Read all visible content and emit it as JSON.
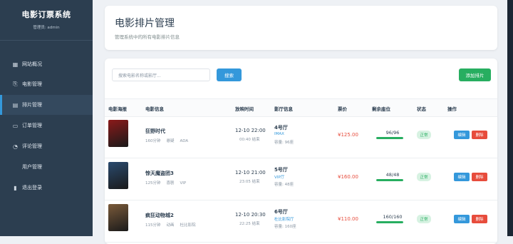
{
  "sidebar": {
    "brand": "电影订票系统",
    "admin": "管理员: admin",
    "items": [
      {
        "label": "网站概况",
        "icon": "dashboard-icon",
        "active": false
      },
      {
        "label": "电影管理",
        "icon": "film-icon",
        "active": false
      },
      {
        "label": "排片管理",
        "icon": "schedule-icon",
        "active": true
      },
      {
        "label": "订单管理",
        "icon": "ticket-icon",
        "active": false
      },
      {
        "label": "评论管理",
        "icon": "comment-icon",
        "active": false
      },
      {
        "label": "用户管理",
        "icon": "",
        "active": false
      },
      {
        "label": "退出登录",
        "icon": "logout-icon",
        "active": false
      }
    ]
  },
  "header": {
    "title": "电影排片管理",
    "subtitle": "管理系统中的所有电影排片信息"
  },
  "toolbar": {
    "search_placeholder": "搜索电影名称或影厅...",
    "search_label": "搜索",
    "add_label": "添加排片"
  },
  "table": {
    "columns": [
      "电影海报",
      "电影信息",
      "放映时间",
      "影厅信息",
      "票价",
      "剩余座位",
      "状态",
      "操作"
    ],
    "rows": [
      {
        "title": "狂野时代",
        "duration": "160分钟",
        "genre": "悬疑",
        "language": "ADA",
        "start": "12-10 22:00",
        "end": "00:40 结束",
        "hall": "4号厅",
        "hall_type": "IMAX",
        "capacity": "容量: 96座",
        "price": "¥125.00",
        "seats": "96/96",
        "seat_ratio": 1.0,
        "status": "正常",
        "edit": "编辑",
        "delete": "删除",
        "poster_color": "#8b1a1a"
      },
      {
        "title": "惊天魔盗团3",
        "duration": "125分钟",
        "genre": "喜剧",
        "language": "VIP",
        "start": "12-10 21:00",
        "end": "23:05 结束",
        "hall": "5号厅",
        "hall_type": "VIP厅",
        "capacity": "容量: 48座",
        "price": "¥160.00",
        "seats": "48/48",
        "seat_ratio": 1.0,
        "status": "正常",
        "edit": "编辑",
        "delete": "删除",
        "poster_color": "#2a4a6e"
      },
      {
        "title": "疯狂动物城2",
        "duration": "115分钟",
        "genre": "动画",
        "language": "杜比影院",
        "start": "12-10 20:30",
        "end": "22:25 结束",
        "hall": "6号厅",
        "hall_type": "杜比影院厅",
        "capacity": "容量: 160座",
        "price": "¥110.00",
        "seats": "160/160",
        "seat_ratio": 1.0,
        "status": "正常",
        "edit": "编辑",
        "delete": "删除",
        "poster_color": "#7a5a3a"
      }
    ]
  }
}
